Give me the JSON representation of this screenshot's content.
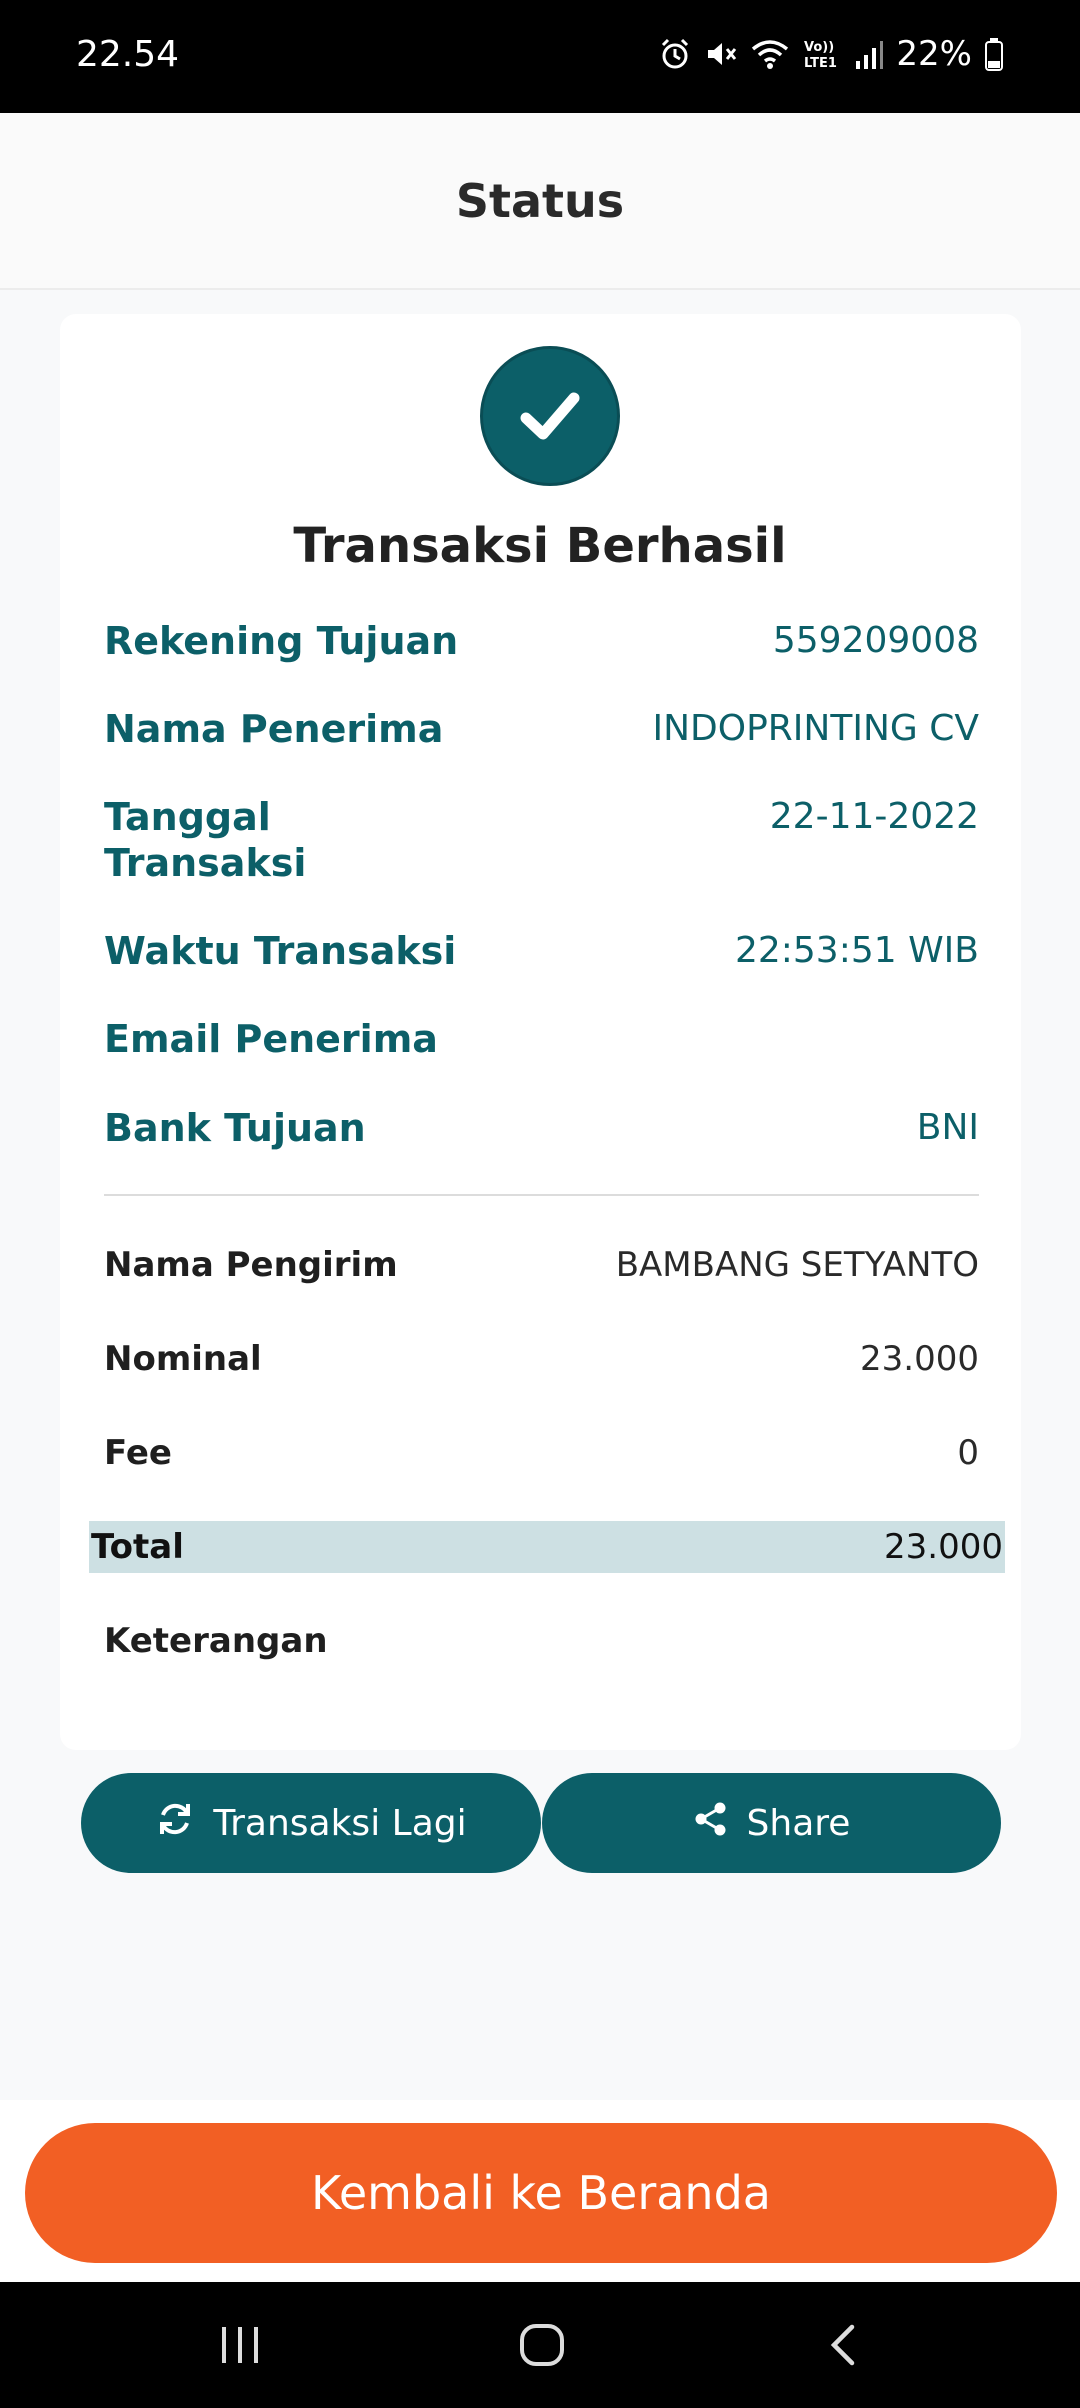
{
  "status_bar": {
    "time": "22.54",
    "battery": "22%",
    "icons": [
      "alarm-icon",
      "mute-icon",
      "wifi-icon",
      "volte-icon",
      "signal-icon",
      "battery-icon"
    ]
  },
  "header": {
    "title": "Status"
  },
  "result": {
    "icon": "check-icon",
    "title": "Transaksi Berhasil"
  },
  "details": [
    {
      "label": "Rekening Tujuan",
      "value": "559209008"
    },
    {
      "label": "Nama Penerima",
      "value": "INDOPRINTING CV"
    },
    {
      "label": "Tanggal Transaksi",
      "value": "22-11-2022"
    },
    {
      "label": "Waktu Transaksi",
      "value": "22:53:51 WIB"
    },
    {
      "label": "Email Penerima",
      "value": ""
    },
    {
      "label": "Bank Tujuan",
      "value": "BNI"
    }
  ],
  "summary": [
    {
      "label": "Nama Pengirim",
      "value": "BAMBANG SETYANTO"
    },
    {
      "label": "Nominal",
      "value": "23.000"
    },
    {
      "label": "Fee",
      "value": "0"
    }
  ],
  "total": {
    "label": "Total",
    "value": "23.000"
  },
  "note": {
    "label": "Keterangan",
    "value": ""
  },
  "actions": {
    "again_label": "Transaksi Lagi",
    "share_label": "Share",
    "home_label": "Kembali ke Beranda"
  },
  "colors": {
    "primary": "#0c5f68",
    "accent": "#f25f24",
    "total_band": "#cde0e3"
  }
}
